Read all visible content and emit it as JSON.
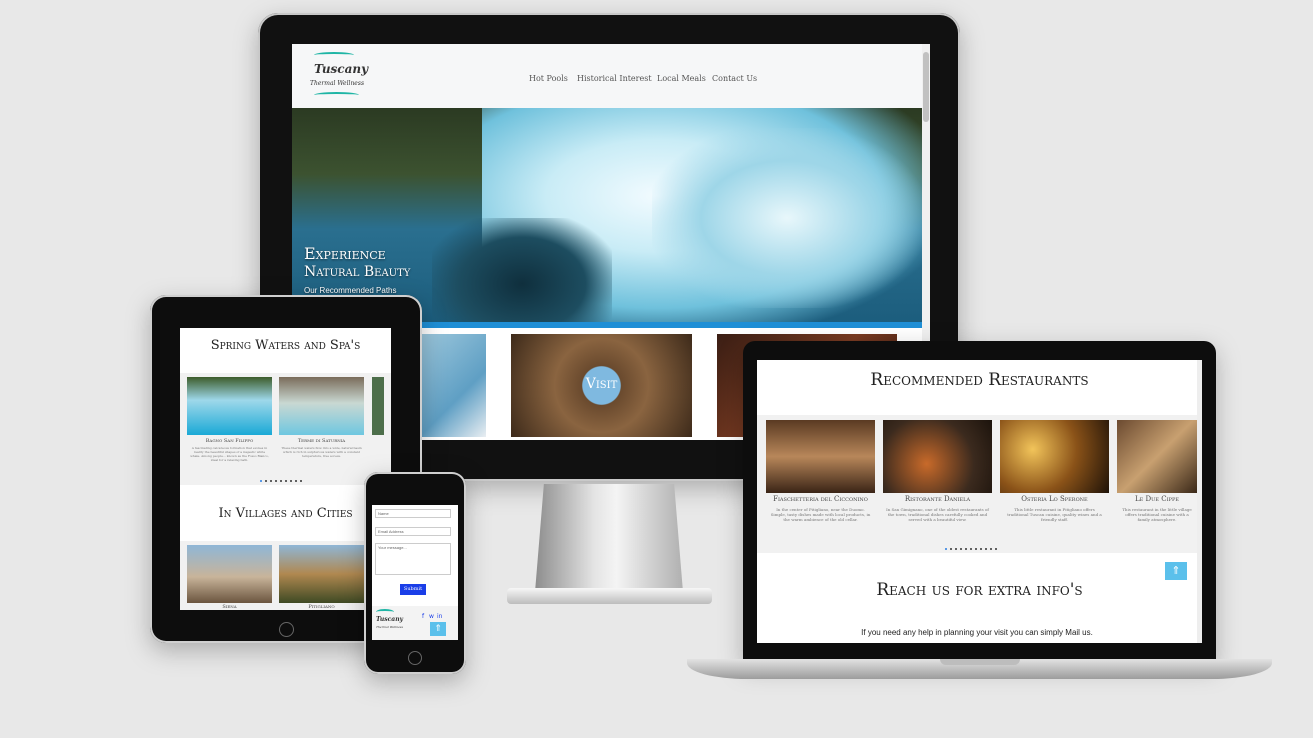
{
  "desktop": {
    "logo": {
      "name": "Tuscany",
      "sub": "Thermal Wellness"
    },
    "nav": [
      "Hot Pools",
      "Historical Interest",
      "Local Meals",
      "Contact Us"
    ],
    "hero": {
      "line1": "Experience",
      "line2": "Natural Beauty",
      "link": "Our Recommended Paths"
    },
    "strip_overlay": "Visit"
  },
  "tablet": {
    "section1_title": "Spring Waters and Spa's",
    "spa_cards": [
      {
        "name": "Bagno San Filippo",
        "text": "A fascinating calcareous formation that evokes in reality the beautiful shapes of a majestic white whale. Among people... known as the Fosso Bianco, ideal for a relaxing bath."
      },
      {
        "name": "Terme di Saturnia",
        "text": "These thermal waters flow into a wide, natural basin which is rich in sulphurous waters with a constant temperature, free access."
      }
    ],
    "section2_title": "In Villages and Cities",
    "city_cards": [
      {
        "name": "Siena"
      },
      {
        "name": "Pitigliano"
      }
    ]
  },
  "phone": {
    "name_placeholder": "Name",
    "email_placeholder": "Email Address",
    "message_placeholder": "Your message...",
    "submit": "Submit",
    "logo": {
      "name": "Tuscany",
      "sub": "Thermal Wellness"
    }
  },
  "laptop": {
    "section_title": "Recommended Restaurants",
    "restaurants": [
      {
        "name": "Fiaschetteria del Cicconino",
        "text": "In the center of Pitigliano, near the Duomo. Simple, tasty dishes made with local products, in the warm ambience of the old cellar."
      },
      {
        "name": "Ristorante Daniela",
        "text": "In San Gimignano, one of the oldest restaurants of the town, traditional dishes carefully cooked and served with a beautiful view."
      },
      {
        "name": "Osteria Lo Sperone",
        "text": "This little restaurant in Pitigliano offers traditional Tuscan cuisine, quality wines and a friendly staff."
      },
      {
        "name": "Le Due Cippe",
        "text": "This restaurant in the little village offers traditional cuisine with a family atmosphere."
      }
    ],
    "contact_title": "Reach us for extra info's",
    "contact_text": "If you need any help in planning your visit you can simply Mail us."
  },
  "icons": {
    "facebook": "f",
    "whatsapp": "w",
    "linkedin": "in",
    "arrow_up": "⇑"
  },
  "colors": {
    "accent": "#1fb5a5",
    "button_blue": "#1a3ee8",
    "top_button": "#5bc0eb"
  }
}
